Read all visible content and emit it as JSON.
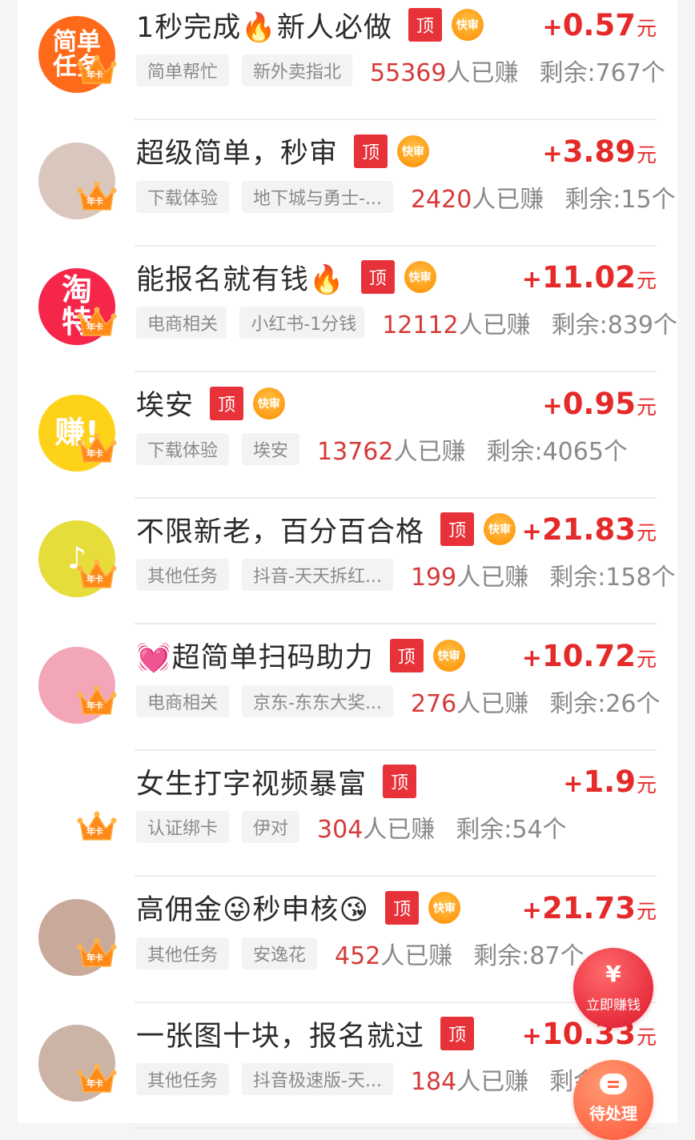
{
  "labels": {
    "top_badge": "顶",
    "fast_badge": "快审",
    "annual_badge": "年卡",
    "earned_suffix": "人已赚",
    "reward_unit": "元"
  },
  "colors": {
    "accent_red": "#e52a2a",
    "fast_orange": "#ff9c14",
    "tag_bg": "#f3f3f3"
  },
  "tasks": [
    {
      "title": "1秒完成🔥新人必做",
      "fast": true,
      "reward": "+0.57",
      "category": "简单帮忙",
      "app": "新外卖指北",
      "earned": "55369",
      "remaining": "剩余:767个",
      "avatar": {
        "text": "简单任务",
        "bg": "#ff6a1a",
        "icon": "simple-task-logo"
      }
    },
    {
      "title": "超级简单，秒审",
      "fast": true,
      "reward": "+3.89",
      "category": "下载体验",
      "app": "地下城与勇士-...",
      "earned": "2420",
      "remaining": "剩余:15个",
      "avatar": {
        "text": "",
        "bg": "#d9c6bd",
        "icon": "girl-photo"
      }
    },
    {
      "title": "能报名就有钱🔥",
      "fast": true,
      "reward": "+11.02",
      "category": "电商相关",
      "app": "小红书-1分钱",
      "earned": "12112",
      "remaining": "剩余:839个",
      "avatar": {
        "text": "淘特",
        "bg": "#f5264a",
        "icon": "taote-logo"
      }
    },
    {
      "title": "埃安",
      "fast": true,
      "reward": "+0.95",
      "category": "下载体验",
      "app": "埃安",
      "earned": "13762",
      "remaining": "剩余:4065个",
      "avatar": {
        "text": "赚!",
        "bg": "#ffd21a",
        "icon": "zhuan-logo"
      }
    },
    {
      "title": "不限新老，百分百合格",
      "fast": true,
      "reward": "+21.83",
      "category": "其他任务",
      "app": "抖音-天天拆红...",
      "earned": "199",
      "remaining": "剩余:158个",
      "avatar": {
        "text": "♪",
        "bg": "#e6dc3a",
        "icon": "music-note-logo"
      }
    },
    {
      "title": "💓超简单扫码助力",
      "fast": true,
      "reward": "+10.72",
      "category": "电商相关",
      "app": "京东-东东大奖...",
      "earned": "276",
      "remaining": "剩余:26个",
      "avatar": {
        "text": "",
        "bg": "#f2a6b8",
        "icon": "anime-girl-avatar"
      }
    },
    {
      "title": "女生打字视频暴富",
      "fast": false,
      "reward": "+1.9",
      "category": "认证绑卡",
      "app": "伊对",
      "earned": "304",
      "remaining": "剩余:54个",
      "avatar": {
        "text": "",
        "bg": "#ffffff",
        "icon": "blank-avatar"
      }
    },
    {
      "title": "高佣金😜秒申核😘",
      "fast": true,
      "reward": "+21.73",
      "category": "其他任务",
      "app": "安逸花",
      "earned": "452",
      "remaining": "剩余:87个",
      "avatar": {
        "text": "",
        "bg": "#c9a99a",
        "icon": "girl-photo"
      }
    },
    {
      "title": "一张图十块，报名就过",
      "fast": false,
      "reward": "+10.33",
      "category": "其他任务",
      "app": "抖音极速版-天...",
      "earned": "184",
      "remaining": "剩余",
      "avatar": {
        "text": "",
        "bg": "#cbb3a5",
        "icon": "girl-glasses-photo"
      }
    }
  ],
  "fab": {
    "earn_now": {
      "symbol": "¥",
      "label": "立即赚钱"
    },
    "pending": {
      "label": "待处理"
    }
  }
}
